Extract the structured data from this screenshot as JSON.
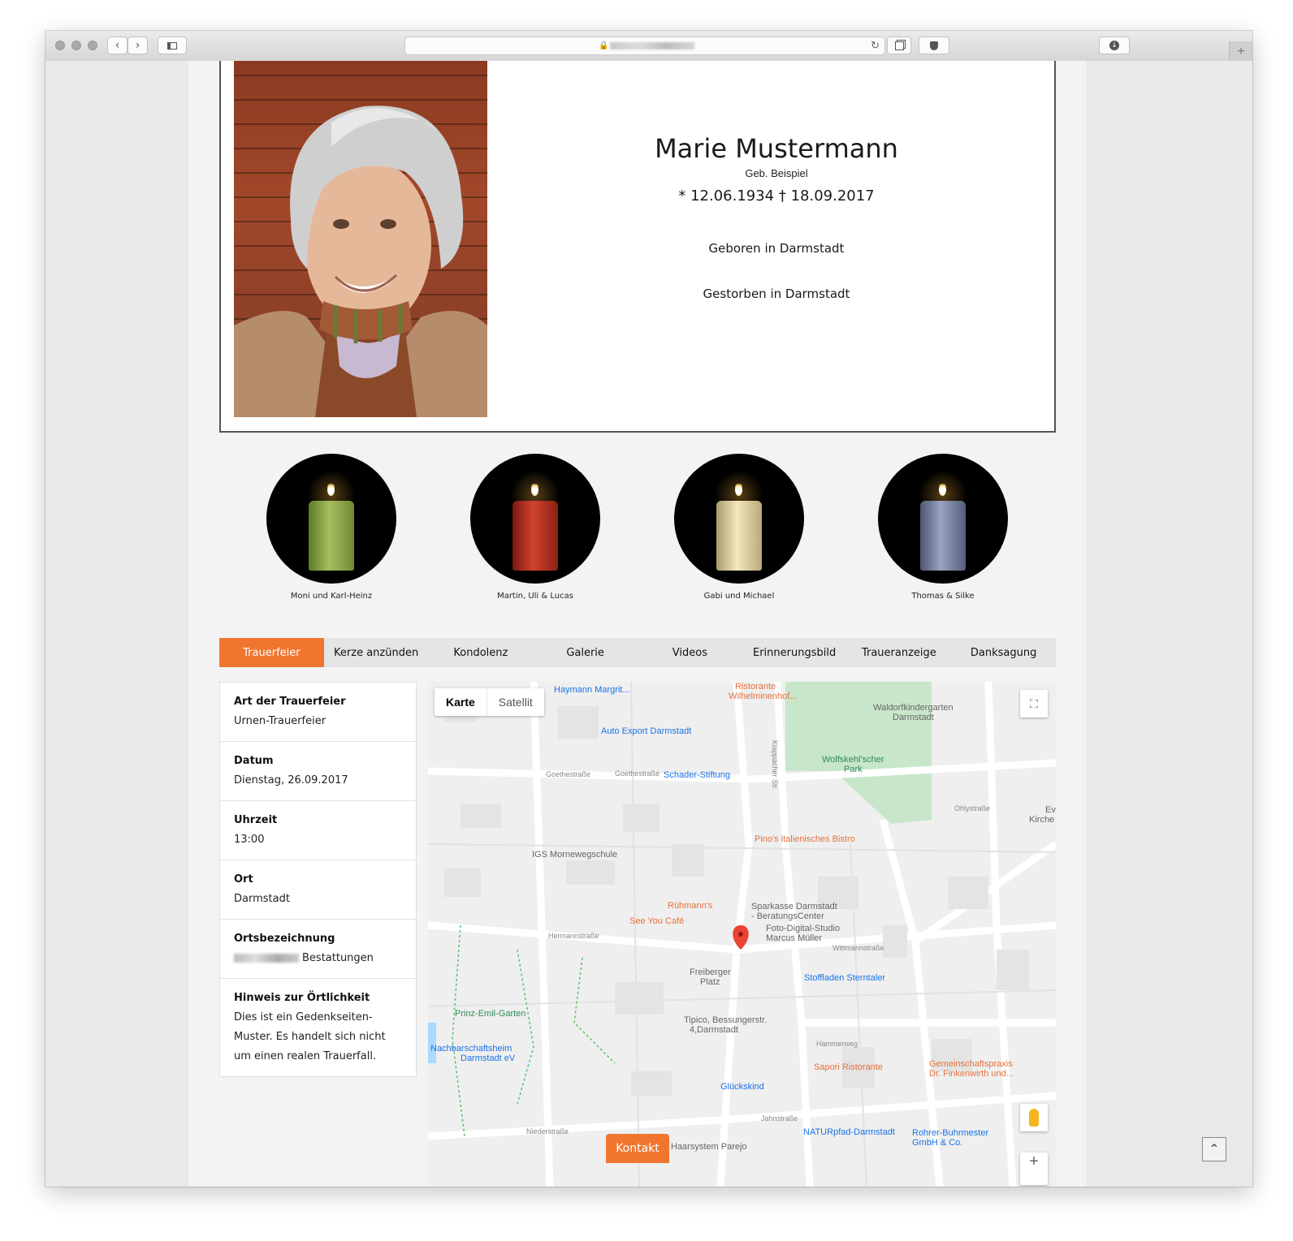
{
  "browser": {
    "back_icon": "chevron-left-icon",
    "forward_icon": "chevron-right-icon",
    "new_tab_label": "+"
  },
  "profile": {
    "name": "Marie Mustermann",
    "maiden_name": "Geb. Beispiel",
    "dates": "* 12.06.1934   † 18.09.2017",
    "born_place": "Geboren in Darmstadt",
    "died_place": "Gestorben in Darmstadt"
  },
  "candles": [
    {
      "label": "Moni und Karl-Heinz",
      "color": "#8aa14a"
    },
    {
      "label": "Martin, Uli & Lucas",
      "color": "#b32a1c"
    },
    {
      "label": "Gabi und Michael",
      "color": "#e0d4a0"
    },
    {
      "label": "Thomas & Silke",
      "color": "#7b84a3"
    }
  ],
  "tabs": [
    {
      "label": "Trauerfeier",
      "active": true
    },
    {
      "label": "Kerze anzünden"
    },
    {
      "label": "Kondolenz"
    },
    {
      "label": "Galerie"
    },
    {
      "label": "Videos"
    },
    {
      "label": "Erinnerungsbild"
    },
    {
      "label": "Traueranzeige"
    },
    {
      "label": "Danksagung"
    }
  ],
  "details": [
    {
      "label": "Art der Trauerfeier",
      "value": "Urnen-Trauerfeier"
    },
    {
      "label": "Datum",
      "value": "Dienstag, 26.09.2017"
    },
    {
      "label": "Uhrzeit",
      "value": "13:00"
    },
    {
      "label": "Ort",
      "value": "Darmstadt"
    },
    {
      "label": "Ortsbezeichnung",
      "value": "Bestattungen"
    },
    {
      "label": "Hinweis zur Örtlichkeit",
      "value": "Dies ist ein Gedenkseiten-Muster. Es handelt sich nicht um einen realen Trauerfall."
    }
  ],
  "map": {
    "tab_map": "Karte",
    "tab_satellite": "Satellit",
    "labels": [
      {
        "text": "Haymann Margrit...",
        "cls": "ml-blue"
      },
      {
        "text": "Ristorante",
        "cls": "ml-orange"
      },
      {
        "text": "Wilhelminenhof...",
        "cls": "ml-orange"
      },
      {
        "text": "Waldorfkindergarten",
        "cls": "ml-gray"
      },
      {
        "text": "Darmstadt",
        "cls": "ml-gray"
      },
      {
        "text": "Auto Export Darmstadt",
        "cls": "ml-blue"
      },
      {
        "text": "Goethestraße",
        "cls": "ml-sm"
      },
      {
        "text": "Goethestraße",
        "cls": "ml-sm"
      },
      {
        "text": "Schader-Stiftung",
        "cls": "ml-blue"
      },
      {
        "text": "Wolfskehl'scher",
        "cls": "ml-green"
      },
      {
        "text": "Park",
        "cls": "ml-green"
      },
      {
        "text": "Ohlystraße",
        "cls": "ml-sm"
      },
      {
        "text": "Ev",
        "cls": "ml-gray"
      },
      {
        "text": "Kirche",
        "cls": "ml-gray"
      },
      {
        "text": "Pino's italienisches Bistro",
        "cls": "ml-orange"
      },
      {
        "text": "IGS Mornewegschule",
        "cls": "ml-gray"
      },
      {
        "text": "Rühmann's",
        "cls": "ml-orange"
      },
      {
        "text": "Sparkasse Darmstadt",
        "cls": "ml-gray"
      },
      {
        "text": "- BeratungsCenter",
        "cls": "ml-gray"
      },
      {
        "text": "See You Café",
        "cls": "ml-orange"
      },
      {
        "text": "Foto-Digital-Studio",
        "cls": "ml-gray"
      },
      {
        "text": "Marcus Müller",
        "cls": "ml-gray"
      },
      {
        "text": "Hermannstraße",
        "cls": "ml-sm"
      },
      {
        "text": "Wittmannstraße",
        "cls": "ml-sm"
      },
      {
        "text": "Freiberger",
        "cls": "ml-gray"
      },
      {
        "text": "Platz",
        "cls": "ml-gray"
      },
      {
        "text": "Stoffladen Sterntaler",
        "cls": "ml-blue"
      },
      {
        "text": "Prinz-Emil-Garten",
        "cls": "ml-green"
      },
      {
        "text": "Tipico, Bessungerstr.",
        "cls": "ml-gray"
      },
      {
        "text": "4,Darmstadt",
        "cls": "ml-gray"
      },
      {
        "text": "Nachbarschaftsheim",
        "cls": "ml-blue"
      },
      {
        "text": "Darmstadt eV",
        "cls": "ml-blue"
      },
      {
        "text": "Sapori Ristorante",
        "cls": "ml-orange"
      },
      {
        "text": "Gemeinschaftspraxis",
        "cls": "ml-orange"
      },
      {
        "text": "Dr. Finkenwirth und...",
        "cls": "ml-orange"
      },
      {
        "text": "Glückskind",
        "cls": "ml-blue"
      },
      {
        "text": "Niederstraße",
        "cls": "ml-sm"
      },
      {
        "text": "NATURpfad-Darmstadt",
        "cls": "ml-blue"
      },
      {
        "text": "Rohrer-Buhrmester",
        "cls": "ml-blue"
      },
      {
        "text": "GmbH & Co.",
        "cls": "ml-blue"
      },
      {
        "text": "Haarsystem Parejo",
        "cls": "ml-gray"
      },
      {
        "text": "Klappacher Str.",
        "cls": "ml-sm"
      },
      {
        "text": "Hammerweg",
        "cls": "ml-sm"
      },
      {
        "text": "Jahnstraße",
        "cls": "ml-sm"
      }
    ]
  },
  "kontakt_label": "Kontakt",
  "scroll_top_icon": "chevron-up-icon"
}
